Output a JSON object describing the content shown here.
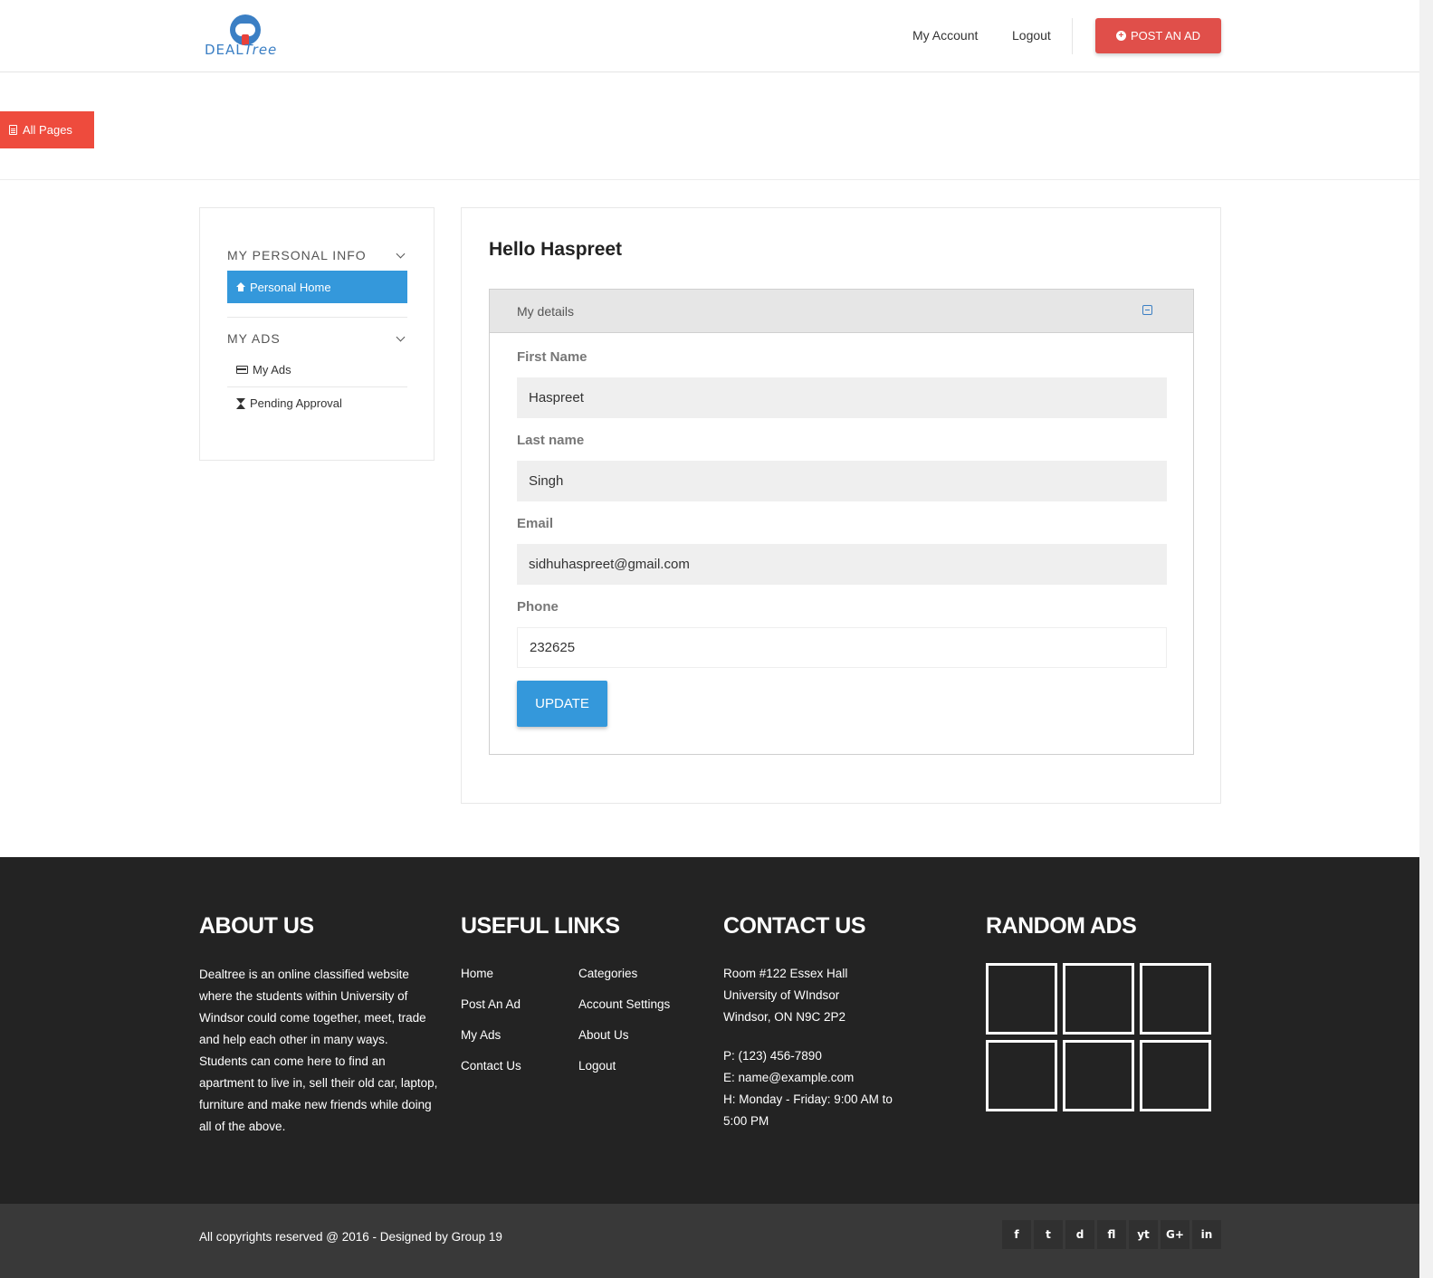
{
  "header": {
    "logo_prefix": "DEAL",
    "logo_suffix": "Tree",
    "nav": {
      "my_account": "My Account",
      "logout": "Logout"
    },
    "post_ad_label": "POST AN AD"
  },
  "all_pages_label": "All Pages",
  "sidebar": {
    "personal_heading": "MY PERSONAL INFO",
    "personal_home": "Personal Home",
    "ads_heading": "MY ADS",
    "my_ads": "My Ads",
    "pending": "Pending Approval"
  },
  "main": {
    "greeting": "Hello Haspreet",
    "panel_title": "My details",
    "fields": {
      "first_name": {
        "label": "First Name",
        "value": "Haspreet"
      },
      "last_name": {
        "label": "Last name",
        "value": "Singh"
      },
      "email": {
        "label": "Email",
        "value": "sidhuhaspreet@gmail.com"
      },
      "phone": {
        "label": "Phone",
        "value": "232625"
      }
    },
    "update_label": "UPDATE"
  },
  "footer": {
    "about": {
      "title": "ABOUT US",
      "text": "Dealtree is an online classified website where the students within University of Windsor could come together, meet, trade and help each other in many ways. Students can come here to find an apartment to live in, sell their old car, laptop, furniture and make new friends while doing all of the above."
    },
    "links": {
      "title": "USEFUL LINKS",
      "col1": [
        "Home",
        "Post An Ad",
        "My Ads",
        "Contact Us"
      ],
      "col2": [
        "Categories",
        "Account Settings",
        "About Us",
        "Logout"
      ]
    },
    "contact": {
      "title": "CONTACT US",
      "address": [
        "Room #122 Essex Hall",
        "University of WIndsor",
        "Windsor, ON N9C 2P2"
      ],
      "phone": "P: (123) 456-7890",
      "email": "E: name@example.com",
      "hours": [
        "H: Monday - Friday: 9:00 AM to",
        "5:00 PM"
      ]
    },
    "random_ads": {
      "title": "RANDOM ADS"
    }
  },
  "bottom": {
    "copyright": "All copyrights reserved @ 2016 - Designed by Group 19",
    "social": [
      "f",
      "t",
      "d",
      "fl",
      "yt",
      "G+",
      "in"
    ]
  },
  "colors": {
    "primary": "#3498db",
    "accent": "#e04f4a",
    "footer": "#232323"
  }
}
